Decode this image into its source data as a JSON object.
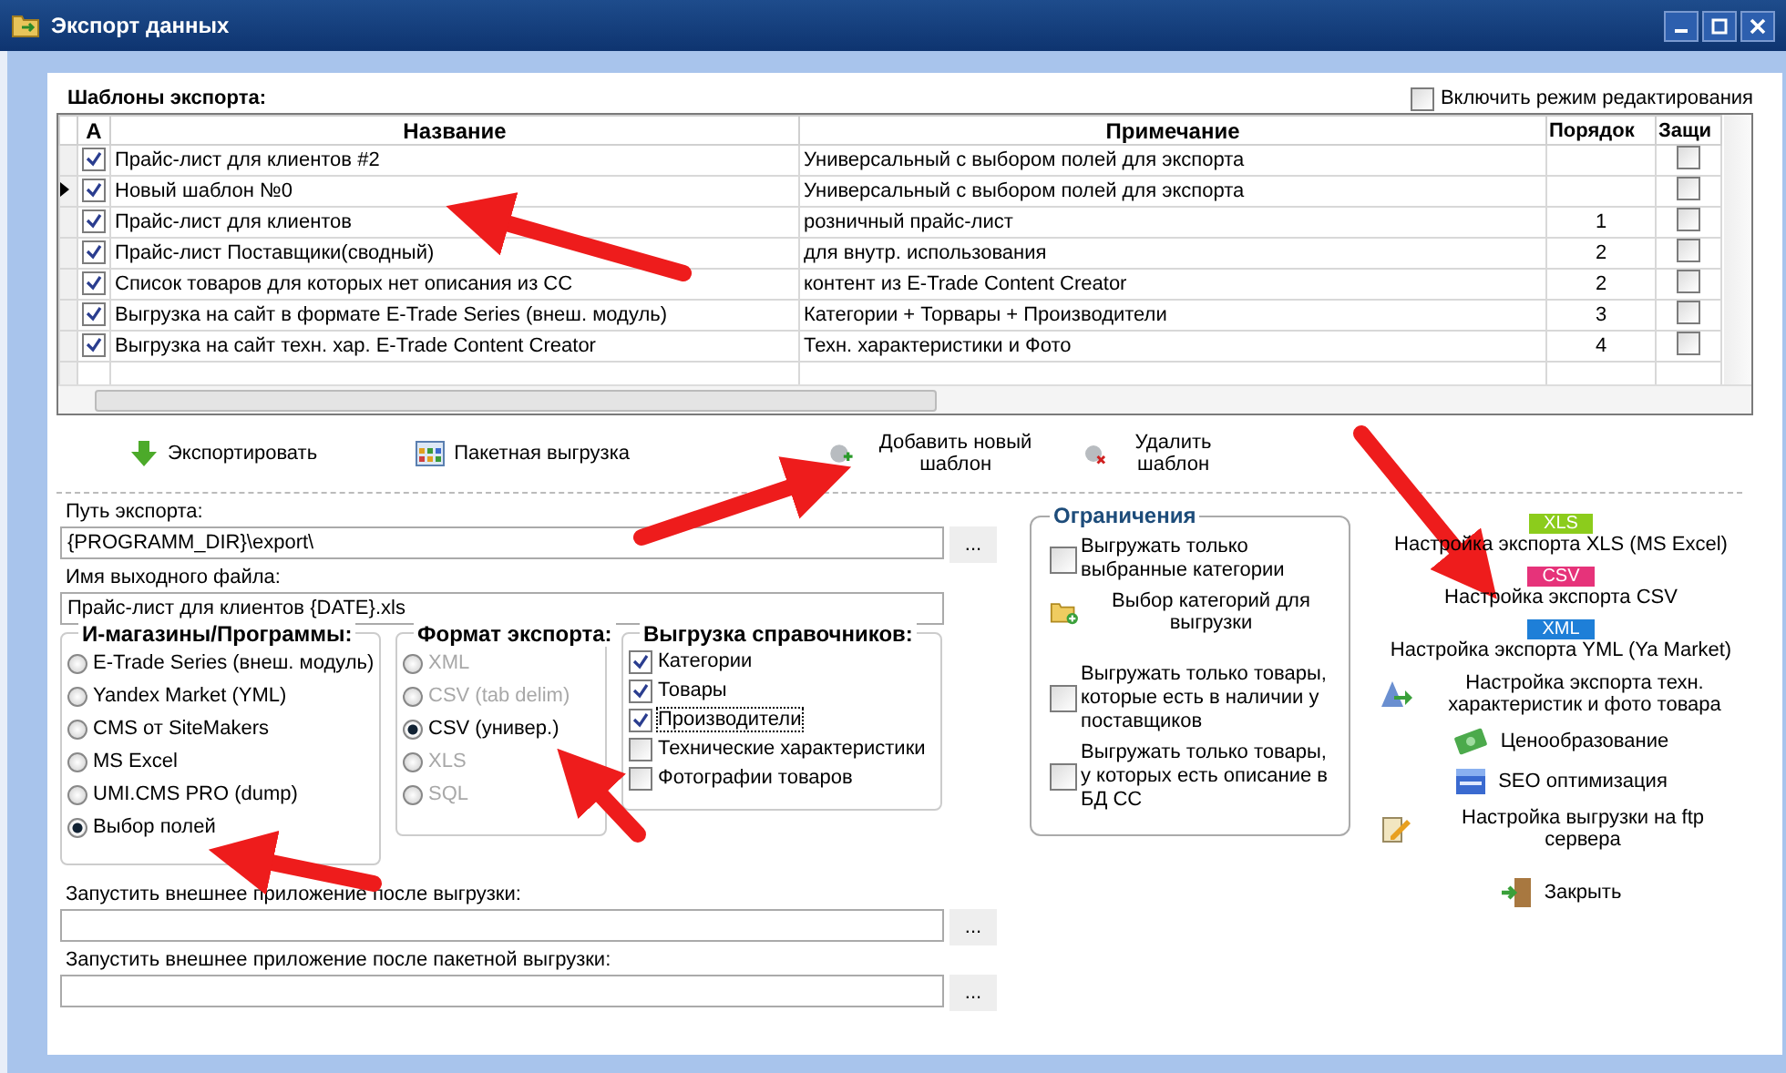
{
  "window": {
    "title": "Экспорт данных"
  },
  "templates_label": "Шаблоны экспорта:",
  "edit_mode": {
    "label": "Включить режим редактирования",
    "checked": false
  },
  "table": {
    "columns": [
      "A",
      "Название",
      "Примечание",
      "Порядок",
      "Защи"
    ],
    "rows": [
      {
        "current": false,
        "active": true,
        "name": "Прайс-лист для клиентов #2",
        "note": "Универсальный с выбором полей для экспорта",
        "order": "",
        "protected": false
      },
      {
        "current": true,
        "active": true,
        "name": "Новый шаблон №0",
        "note": "Универсальный с выбором полей для экспорта",
        "order": "",
        "protected": false
      },
      {
        "current": false,
        "active": true,
        "name": "Прайс-лист для клиентов",
        "note": "розничный прайс-лист",
        "order": "1",
        "protected": false
      },
      {
        "current": false,
        "active": true,
        "name": "Прайс-лист Поставщики(сводный)",
        "note": "для внутр. использования",
        "order": "2",
        "protected": false
      },
      {
        "current": false,
        "active": true,
        "name": "Список товаров для которых нет описания из CC",
        "note": "контент из E-Trade Content Creator",
        "order": "2",
        "protected": false
      },
      {
        "current": false,
        "active": true,
        "name": "Выгрузка на сайт в формате E-Trade Series (внеш. модуль)",
        "note": "Категории + Торвары + Производители",
        "order": "3",
        "protected": false
      },
      {
        "current": false,
        "active": true,
        "name": "Выгрузка на сайт техн. хар. E-Trade Content Creator",
        "note": "Техн. характеристики и Фото",
        "order": "4",
        "protected": false
      }
    ]
  },
  "actions": [
    {
      "kind": "export",
      "label": "Экспортировать"
    },
    {
      "kind": "batch",
      "label": "Пакетная выгрузка"
    },
    {
      "kind": "add",
      "label": "Добавить новый шаблон"
    },
    {
      "kind": "delete",
      "label": "Удалить шаблон"
    }
  ],
  "export_path": {
    "label": "Путь экспорта:",
    "value": "{PROGRAMM_DIR}\\export\\",
    "button": "..."
  },
  "file_name": {
    "label": "Имя выходного файла:",
    "value": "Прайс-лист для клиентов {DATE}.xls"
  },
  "shops": {
    "title": "И-магазины/Программы:",
    "options": [
      {
        "label": "E-Trade Series (внеш. модуль)",
        "selected": false
      },
      {
        "label": "Yandex Market (YML)",
        "selected": false
      },
      {
        "label": "CMS от SiteMakers",
        "selected": false
      },
      {
        "label": "MS Excel",
        "selected": false
      },
      {
        "label": "UMI.CMS PRO (dump)",
        "selected": false
      },
      {
        "label": "Выбор полей",
        "selected": true
      }
    ]
  },
  "formats": {
    "title": "Формат экспорта:",
    "options": [
      {
        "label": "XML",
        "selected": false,
        "disabled": true
      },
      {
        "label": "CSV (tab delim)",
        "selected": false,
        "disabled": true
      },
      {
        "label": "CSV (универ.)",
        "selected": true,
        "disabled": false
      },
      {
        "label": "XLS",
        "selected": false,
        "disabled": true
      },
      {
        "label": "SQL",
        "selected": false,
        "disabled": true
      }
    ]
  },
  "dictionaries": {
    "title": "Выгрузка справочников:",
    "items": [
      {
        "label": "Категории",
        "checked": true
      },
      {
        "label": "Товары",
        "checked": true
      },
      {
        "label": "Производители",
        "checked": true,
        "focused": true
      },
      {
        "label": "Технические характеристики",
        "checked": false
      },
      {
        "label": "Фотографии товаров",
        "checked": false
      }
    ]
  },
  "limits": {
    "title": "Ограничения",
    "items": [
      {
        "kind": "checkbox",
        "label": "Выгружать только выбранные категории",
        "checked": false
      },
      {
        "kind": "link",
        "label": "Выбор категорий для выгрузки"
      },
      {
        "kind": "checkbox",
        "label": "Выгружать только товары, которые есть в наличии у поставщиков",
        "checked": false
      },
      {
        "kind": "checkbox",
        "label": "Выгружать только товары, у которых есть описание в БД CC",
        "checked": false
      }
    ]
  },
  "settings": [
    {
      "kind": "badge",
      "badge": "XLS",
      "color": "#8ccc1c",
      "label": "Настройка экспорта XLS (MS Excel)"
    },
    {
      "kind": "badge",
      "badge": "CSV",
      "color": "#e6337a",
      "label": "Настройка экспорта CSV"
    },
    {
      "kind": "badge",
      "badge": "XML",
      "color": "#1e7fd8",
      "label": "Настройка экспорта YML (Ya Market)"
    },
    {
      "kind": "tech",
      "label": "Настройка экспорта техн. характеристик и фото товара"
    },
    {
      "kind": "price",
      "label": "Ценообразование"
    },
    {
      "kind": "seo",
      "label": "SEO оптимизация"
    },
    {
      "kind": "ftp",
      "label": "Настройка выгрузки на ftp сервера"
    },
    {
      "kind": "close",
      "label": "Закрыть"
    }
  ],
  "run_after": {
    "label": "Запустить внешнее приложение после выгрузки:",
    "button": "..."
  },
  "run_after_batch": {
    "label": "Запустить внешнее приложение после пакетной выгрузки:",
    "button": "..."
  }
}
